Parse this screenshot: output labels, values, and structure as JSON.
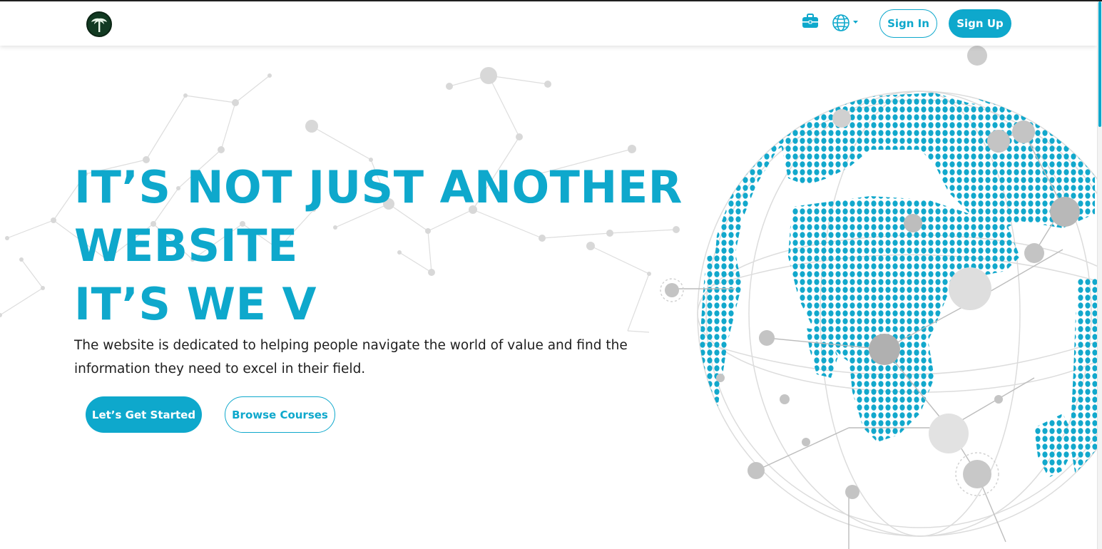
{
  "theme": {
    "accent": "#0ea8cc",
    "text": "#1e1e1e",
    "background": "#ffffff"
  },
  "navbar": {
    "logo_icon": "palm-tree-logo",
    "icons": [
      "briefcase-icon",
      "globe-icon",
      "chevron-down-icon"
    ],
    "sign_in_label": "Sign In",
    "sign_up_label": "Sign Up"
  },
  "hero": {
    "title_lines": [
      "IT’S NOT JUST ANOTHER",
      "WEBSITE",
      "IT’S WE V"
    ],
    "description": "The website is dedicated to helping people navigate the world of value and find the information they need to excel in their field.",
    "primary_button": "Let’s Get Started",
    "secondary_button": "Browse Courses"
  },
  "decor": {
    "background_image": "network-nodes-pattern",
    "hero_image": "dotted-world-globe"
  }
}
